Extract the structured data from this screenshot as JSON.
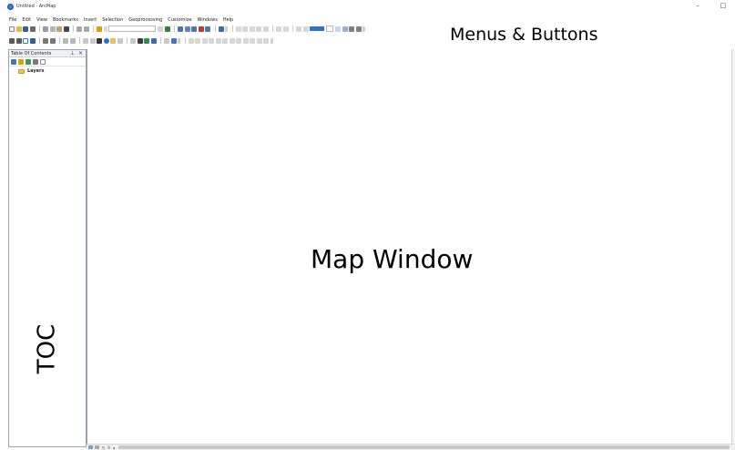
{
  "window": {
    "title": "Untitled - ArcMap",
    "minimize_label": "–",
    "maximize_label": "□"
  },
  "menu": {
    "items": [
      "File",
      "Edit",
      "View",
      "Bookmarks",
      "Insert",
      "Selection",
      "Geoprocessing",
      "Customize",
      "Windows",
      "Help"
    ]
  },
  "toc": {
    "title": "Table Of Contents",
    "pin_label": "⊥",
    "close_label": "×",
    "layers_label": "Layers"
  },
  "annotations": {
    "menus_buttons": "Menus & Buttons",
    "toc": "TOC",
    "map_window": "Map Window"
  },
  "bottombar": {
    "refresh_label": "↻",
    "pause_label": "II",
    "left_label": "◂"
  },
  "colors": {
    "accent": "#2f6fd6",
    "folder": "#f2c14e",
    "toc_border": "#9aa3ad"
  }
}
